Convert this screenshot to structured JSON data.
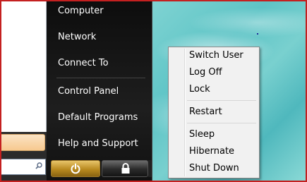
{
  "start_menu": {
    "right_items": [
      "Computer",
      "Network",
      "Connect To",
      "Control Panel",
      "Default Programs",
      "Help and Support"
    ]
  },
  "context_menu": {
    "items": [
      "Switch User",
      "Log Off",
      "Lock",
      "Restart",
      "Sleep",
      "Hibernate",
      "Shut Down"
    ]
  },
  "colors": {
    "frame": "#c42020",
    "menu_bg": "#111111",
    "power_button": "#c99a34",
    "context_bg": "#f1f1f1"
  }
}
